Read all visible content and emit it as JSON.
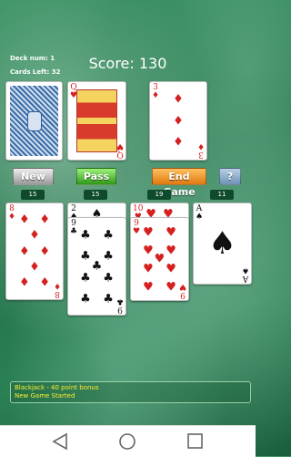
{
  "header": {
    "deck_num": "Deck num: 1",
    "cards_left": "Cards Left: 32",
    "score": "Score: 130"
  },
  "top_cards": [
    {
      "type": "back"
    },
    {
      "type": "face",
      "rank": "Q",
      "suit": "♥",
      "color": "red"
    },
    {
      "type": "pips",
      "rank": "3",
      "suit": "♦",
      "color": "red"
    }
  ],
  "buttons": {
    "new": "New",
    "pass": "Pass",
    "end_game": "End Game",
    "help": "?"
  },
  "counts": [
    "15",
    "15",
    "19",
    "11"
  ],
  "columns": [
    [
      {
        "rank": "8",
        "suit": "♦",
        "color": "red"
      }
    ],
    [
      {
        "rank": "2",
        "suit": "♠",
        "color": "black"
      },
      {
        "rank": "9",
        "suit": "♣",
        "color": "black"
      }
    ],
    [
      {
        "rank": "10",
        "suit": "♥",
        "color": "red"
      },
      {
        "rank": "9",
        "suit": "♥",
        "color": "red"
      }
    ],
    [
      {
        "rank": "A",
        "suit": "♠",
        "color": "black"
      }
    ]
  ],
  "messages": {
    "line1": "Blackjack - 40 point bonus",
    "line2": "New Game Started"
  },
  "colors": {
    "felt": "#2b7f55",
    "message_text": "#ffee33",
    "counter_bg": "#0f4a2c"
  },
  "nav": {
    "back_icon": "triangle-back",
    "home_icon": "circle-home",
    "recents_icon": "square-recents"
  }
}
